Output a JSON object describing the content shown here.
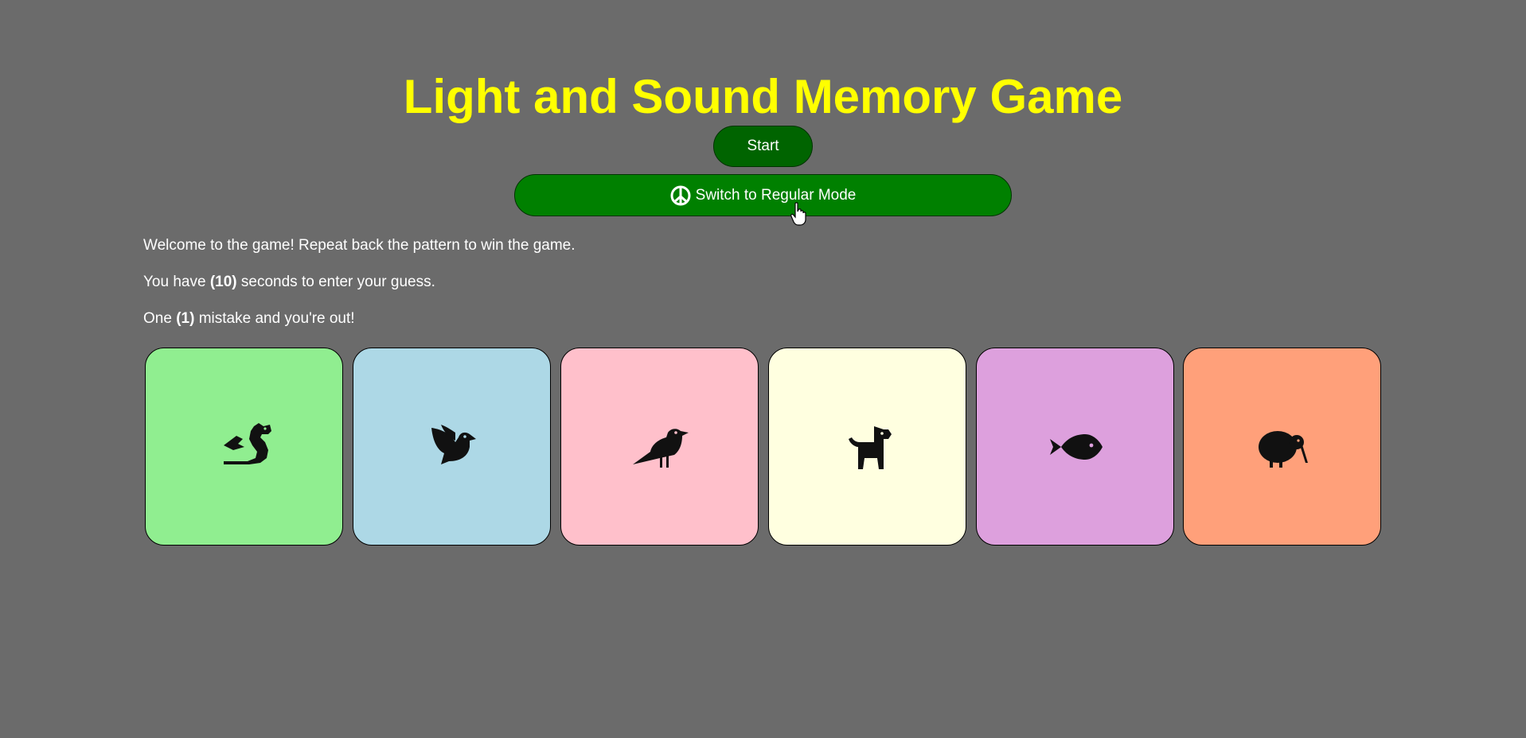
{
  "title": "Light and Sound Memory Game",
  "start_button": {
    "label": "Start"
  },
  "mode_button": {
    "label": "Switch to Regular Mode",
    "icon": "peace-icon"
  },
  "info": {
    "line1": "Welcome to the game! Repeat back the pattern to win the game.",
    "line2_prefix": "You have ",
    "line2_bold": "(10)",
    "line2_suffix": " seconds to enter your guess.",
    "line3_prefix": "One ",
    "line3_bold": "(1)",
    "line3_suffix": " mistake and you're out!"
  },
  "colors": {
    "background": "#6b6b6b",
    "title": "#ffff00",
    "start_button": "#006400",
    "mode_button": "#008000"
  },
  "cards": [
    {
      "icon": "dragon-icon",
      "color": "#90ee90"
    },
    {
      "icon": "dove-icon",
      "color": "#add8e6"
    },
    {
      "icon": "crow-icon",
      "color": "#ffc0cb"
    },
    {
      "icon": "dog-icon",
      "color": "#ffffe0"
    },
    {
      "icon": "fish-icon",
      "color": "#dda0dd"
    },
    {
      "icon": "kiwi-bird-icon",
      "color": "#ffa07a"
    }
  ]
}
